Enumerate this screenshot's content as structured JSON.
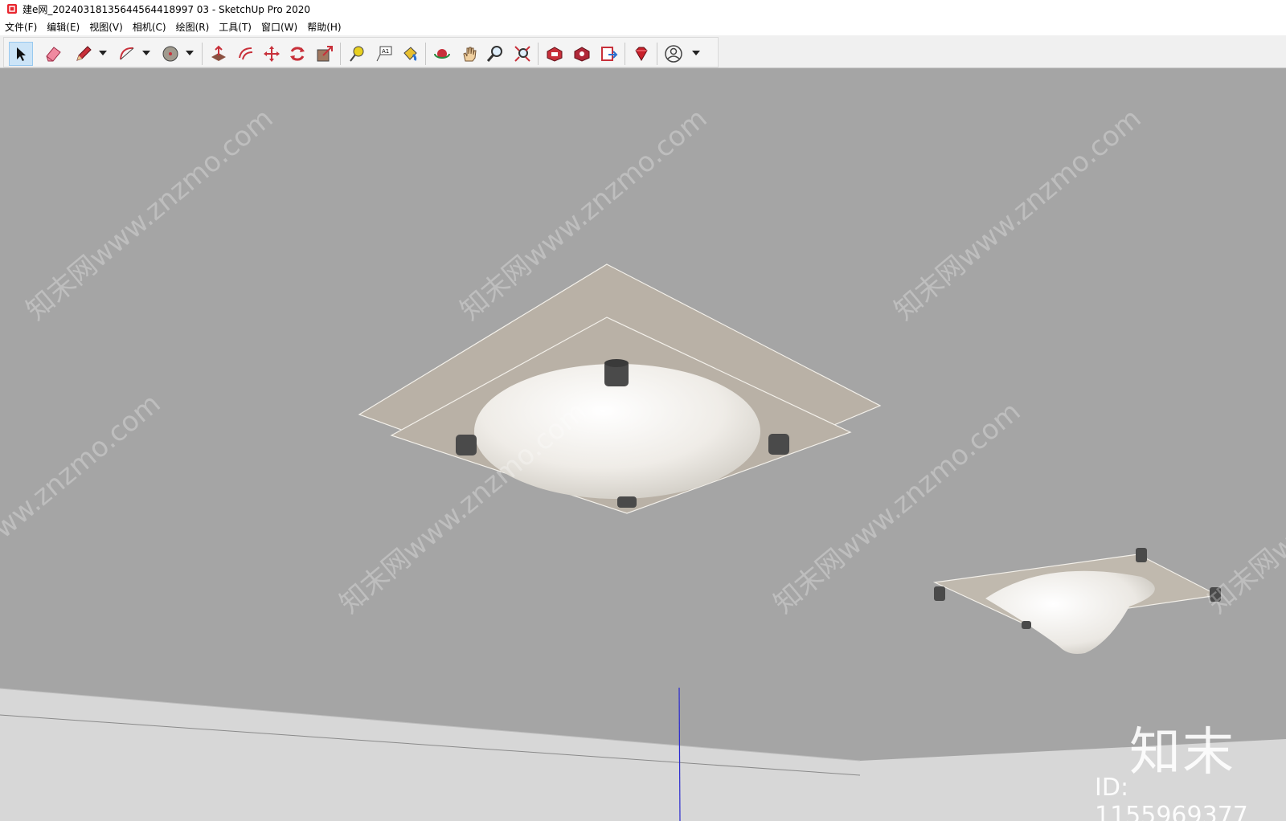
{
  "window": {
    "title": "建e网_20240318135644564418997 03 - SketchUp Pro 2020"
  },
  "menu": {
    "items": [
      "文件(F)",
      "编辑(E)",
      "视图(V)",
      "相机(C)",
      "绘图(R)",
      "工具(T)",
      "窗口(W)",
      "帮助(H)"
    ]
  },
  "toolbar": {
    "tools": [
      "select-tool",
      "eraser-tool",
      "pencil-tool",
      "arc-tool",
      "shape-tool",
      "push-pull-tool",
      "offset-tool",
      "move-tool",
      "rotate-tool",
      "scale-tool",
      "tape-measure-tool",
      "text-tool",
      "paint-bucket-tool",
      "orbit-tool",
      "pan-tool",
      "zoom-tool",
      "zoom-extents-tool",
      "warehouse-tool",
      "extension-warehouse-tool",
      "send-to-layout-tool",
      "ruby-tool",
      "account-tool"
    ]
  },
  "watermarks": {
    "site": "知末网www.znzmo.com"
  },
  "brand": {
    "logo": "知末",
    "id_label": "ID: 1155969377"
  },
  "colors": {
    "viewport": "#a5a5a5",
    "panel_plate": "#b9b1a6",
    "dome": "#f4f2ee",
    "axis_blue": "#2a2ad0"
  }
}
